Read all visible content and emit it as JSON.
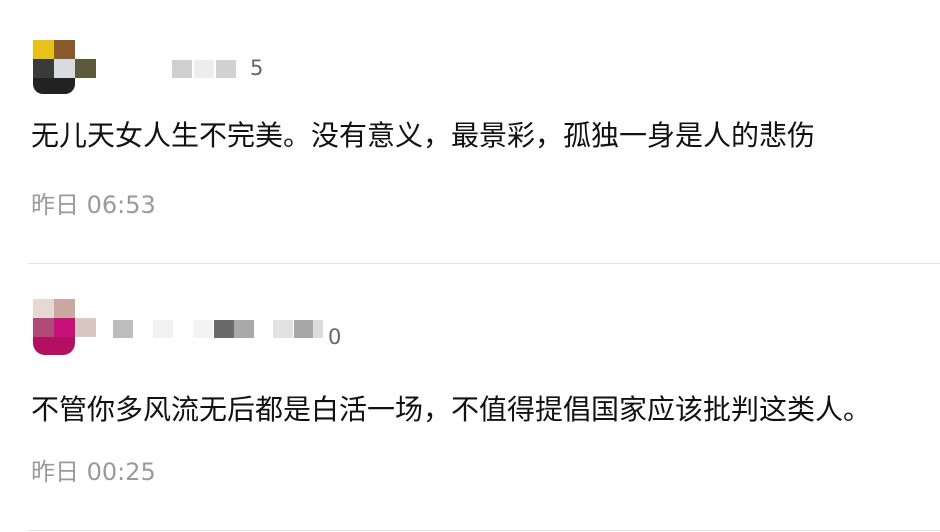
{
  "comments": [
    {
      "level": "5",
      "text": "无儿天女人生不完美。没有意义，最景彩，孤独一身是人的悲伤",
      "time": "昨日 06:53",
      "avatar_colors": [
        "#e8c11a",
        "#8a5a2a",
        "#3a3a3a",
        "#d8dbe0",
        "#5b5a3a",
        "#222222"
      ],
      "nick_colors": [
        "#cfcfcf",
        "#ededed",
        "#d2d2d2"
      ]
    },
    {
      "level": "0",
      "text": "不管你多风流无后都是白活一场，不值得提倡国家应该批判这类人。",
      "time": "昨日 00:25",
      "avatar_colors": [
        "#e6d8d2",
        "#c9a8a2",
        "#b04a78",
        "#c8107a",
        "#d8c6c2",
        "#b41062"
      ],
      "nick_colors": [
        "#bdbdbd",
        "#f1f1f1",
        "#f3f3f3",
        "#6a6a6a",
        "#a9a9a9",
        "#e2e2e2",
        "#a7a7a7",
        "#dcdcdc"
      ]
    }
  ]
}
